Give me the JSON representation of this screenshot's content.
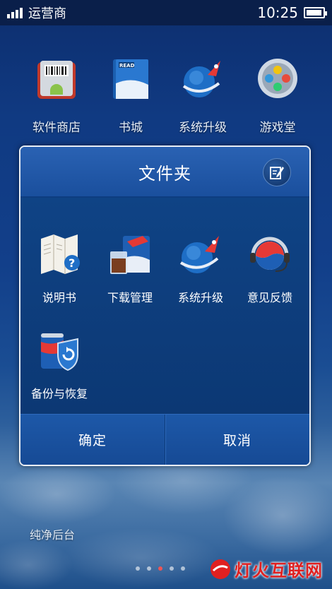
{
  "status_bar": {
    "carrier": "运营商",
    "time": "10:25",
    "battery_level": 0.95
  },
  "desktop": {
    "apps": [
      {
        "label": "软件商店",
        "icon": "app-store-icon"
      },
      {
        "label": "书城",
        "icon": "book-city-icon"
      },
      {
        "label": "系统升级",
        "icon": "rocket-globe-icon"
      },
      {
        "label": "游戏堂",
        "icon": "gamepad-icon"
      }
    ],
    "bottom_label": "纯净后台",
    "page_count": 5,
    "active_page": 3
  },
  "folder": {
    "title": "文件夹",
    "edit_icon": "edit-icon",
    "apps": [
      {
        "label": "说明书",
        "icon": "manual-map-icon"
      },
      {
        "label": "下载管理",
        "icon": "download-drink-icon"
      },
      {
        "label": "系统升级",
        "icon": "rocket-globe-icon"
      },
      {
        "label": "意见反馈",
        "icon": "headset-feedback-icon"
      },
      {
        "label": "备份与恢复",
        "icon": "backup-restore-icon"
      }
    ],
    "confirm_label": "确定",
    "cancel_label": "取消"
  },
  "watermark": {
    "text": "灯火互联网"
  },
  "colors": {
    "accent": "#1a4f9d",
    "dialog_border": "#e9eef5",
    "watermark_red": "#e02020"
  }
}
